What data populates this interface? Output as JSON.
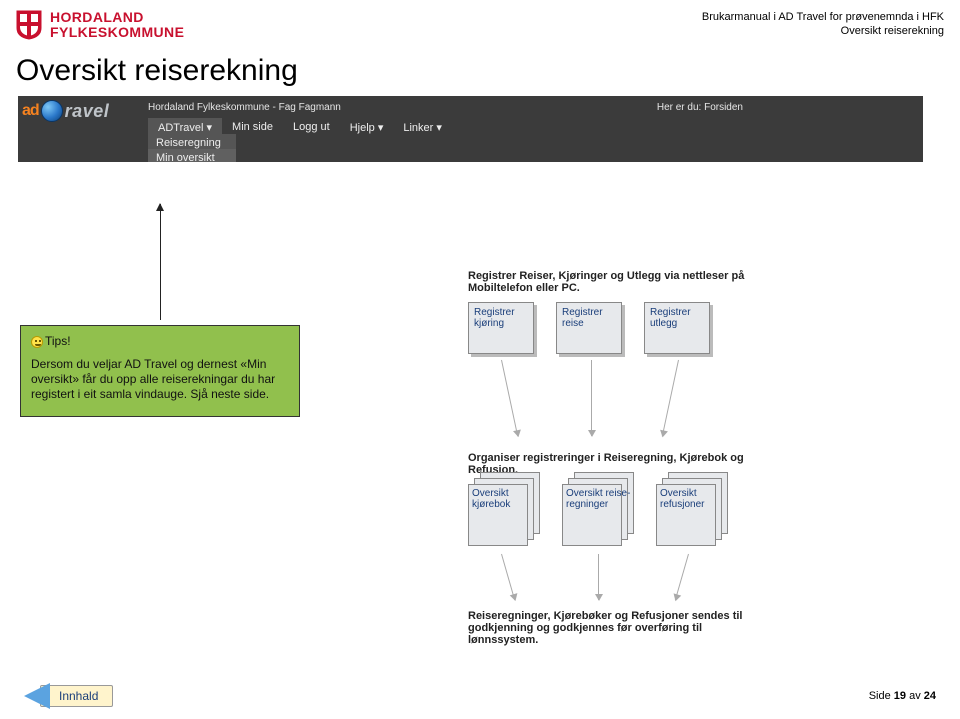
{
  "header": {
    "org_line1": "HORDALAND",
    "org_line2": "FYLKESKOMMUNE",
    "right_line1": "Brukarmanual i AD Travel for prøvenemnda i HFK",
    "right_line2": "Oversikt reiserekning"
  },
  "page_title": "Oversikt reiserekning",
  "app": {
    "breadcrumb_left": "Hordaland Fylkeskommune - Fag Fagmann",
    "breadcrumb_right": "Her er du: Forsiden",
    "nav": {
      "adtravel": "ADTravel",
      "min_side": "Min side",
      "logg_ut": "Logg ut",
      "hjelp": "Hjelp",
      "linker": "Linker",
      "sub1": "Reiseregning",
      "sub2": "Min oversikt"
    },
    "body": {
      "section1": "Registrer Reiser, Kjøringer og Utlegg via nettleser på Mobiltelefon eller PC.",
      "btn_kjoring": "Registrer kjøring",
      "btn_reise": "Registrer reise",
      "btn_utlegg": "Registrer utlegg",
      "section2": "Organiser registreringer i Reiseregning, Kjørebok og Refusjon.",
      "stack_kjorebok": "Oversikt kjørebok",
      "stack_reise": "Oversikt reise-regninger",
      "stack_refusjon": "Oversikt refusjoner",
      "section3": "Reiseregninger, Kjørebøker og Refusjoner sendes til godkjenning og godkjennes før overføring til lønnssystem."
    }
  },
  "tip": {
    "title": "Tips!",
    "body": "Dersom du veljar AD Travel og dernest «Min oversikt» får du opp alle reiserekningar du har registert i eit samla vindauge. Sjå neste side."
  },
  "footer": {
    "back_label": "Innhald",
    "page_prefix": "Side ",
    "page_current": "19",
    "page_sep": " av ",
    "page_total": "24"
  }
}
